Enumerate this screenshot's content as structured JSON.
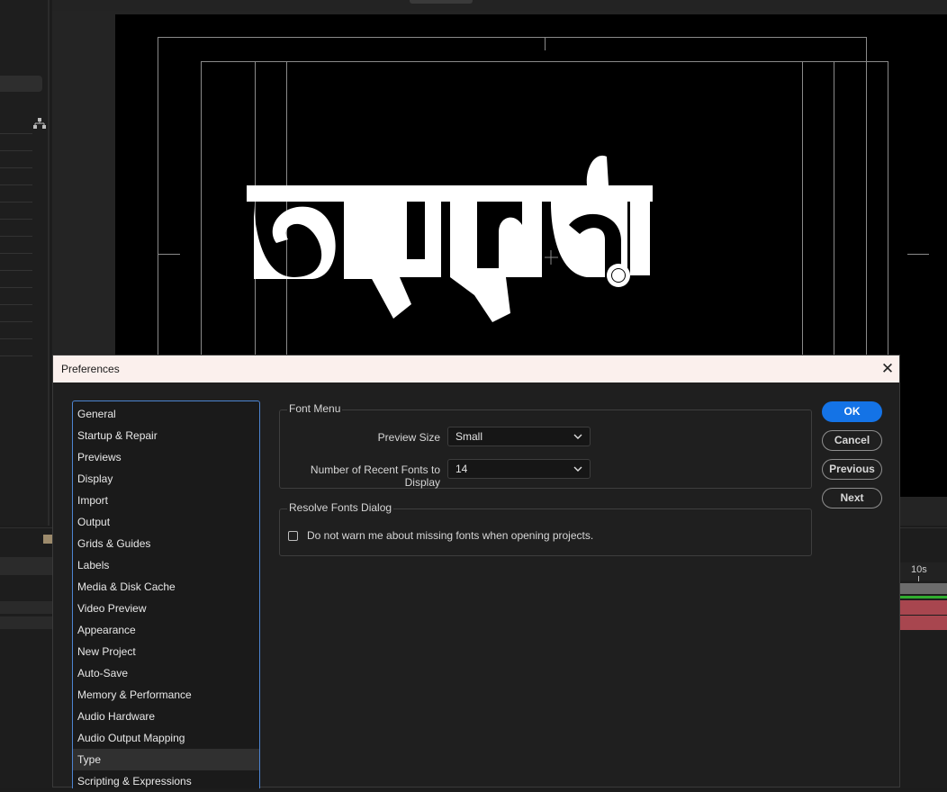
{
  "canvas": {
    "title_text": "অনুভুতি",
    "background": "#000000",
    "title_color": "#ffffff"
  },
  "timeline": {
    "ruler_label": "10s",
    "layer_color": "#a8464f",
    "work_area_color": "#2fae2f"
  },
  "dialog": {
    "title": "Preferences",
    "close_glyph": "✕",
    "nav_items": [
      "General",
      "Startup & Repair",
      "Previews",
      "Display",
      "Import",
      "Output",
      "Grids & Guides",
      "Labels",
      "Media & Disk Cache",
      "Video Preview",
      "Appearance",
      "New Project",
      "Auto-Save",
      "Memory & Performance",
      "Audio Hardware",
      "Audio Output Mapping",
      "Type",
      "Scripting & Expressions"
    ],
    "selected_nav": "Type",
    "font_menu": {
      "label": "Font Menu",
      "preview_size_label": "Preview Size",
      "preview_size_value": "Small",
      "recent_fonts_label": "Number of Recent Fonts to Display",
      "recent_fonts_value": "14"
    },
    "resolve_fonts": {
      "label": "Resolve Fonts Dialog",
      "checkbox_label": "Do not warn me about missing fonts when opening projects.",
      "checked": false
    },
    "buttons": {
      "ok": "OK",
      "cancel": "Cancel",
      "previous": "Previous",
      "next": "Next"
    },
    "accent_color": "#1473e6"
  }
}
